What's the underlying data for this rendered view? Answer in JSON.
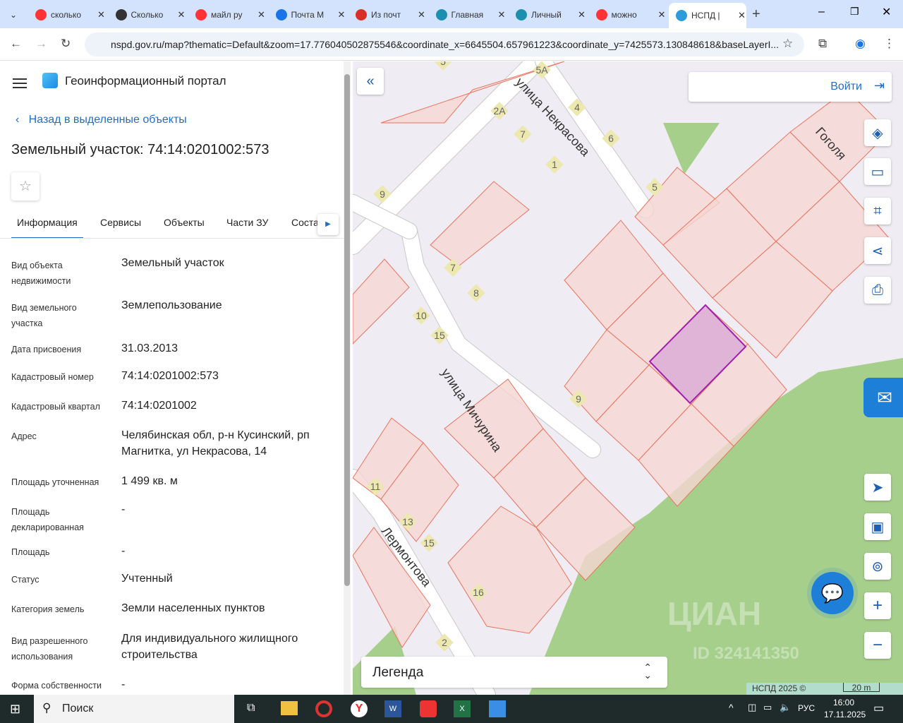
{
  "browser": {
    "tabs": [
      {
        "title": "сколько",
        "icon": "yandex-icon",
        "color": "#f33"
      },
      {
        "title": "Сколько",
        "icon": "emblem-icon",
        "color": "#333"
      },
      {
        "title": "майл ру",
        "icon": "yandex-icon",
        "color": "#f33"
      },
      {
        "title": "Почта М",
        "icon": "mail-icon",
        "color": "#1a73e8"
      },
      {
        "title": "Из почт",
        "icon": "pdf-icon",
        "color": "#d93025"
      },
      {
        "title": "Главная",
        "icon": "gosuslugi-icon",
        "color": "#1a8fb0"
      },
      {
        "title": "Личный",
        "icon": "gosuslugi-icon",
        "color": "#1a8fb0"
      },
      {
        "title": "можно",
        "icon": "yandex-icon",
        "color": "#f33"
      },
      {
        "title": "НСПД |",
        "icon": "nspd-icon",
        "color": "#2d9cdb",
        "active": true
      }
    ],
    "url": "nspd.gov.ru/map?thematic=Default&zoom=17.776040502875546&coordinate_x=6645504.657961223&coordinate_y=7425573.130848618&baseLayerI..."
  },
  "panel": {
    "app_title": "Геоинформационный портал",
    "back_link": "Назад в выделенные объекты",
    "object_title": "Земельный участок: 74:14:0201002:573",
    "tabs": [
      "Информация",
      "Сервисы",
      "Объекты",
      "Части ЗУ",
      "Состав"
    ],
    "active_tab": 0,
    "fields": [
      {
        "k": "Вид объекта недвижимости",
        "v": "Земельный участок"
      },
      {
        "k": "Вид земельного участка",
        "v": "Землепользование"
      },
      {
        "k": "Дата присвоения",
        "v": "31.03.2013"
      },
      {
        "k": "Кадастровый номер",
        "v": "74:14:0201002:573"
      },
      {
        "k": "Кадастровый квартал",
        "v": "74:14:0201002"
      },
      {
        "k": "Адрес",
        "v": "Челябинская обл, р-н Кусинский, рп Магнитка, ул Некрасова, 14"
      },
      {
        "k": "Площадь уточненная",
        "v": "1 499 кв. м"
      },
      {
        "k": "Площадь декларированная",
        "v": "-"
      },
      {
        "k": "Площадь",
        "v": "-"
      },
      {
        "k": "Статус",
        "v": "Учтенный"
      },
      {
        "k": "Категория земель",
        "v": "Земли населенных пунктов"
      },
      {
        "k": "Вид разрешенного использования",
        "v": "Для индивидуального жилищного строительства"
      },
      {
        "k": "Форма собственности",
        "v": "-"
      }
    ]
  },
  "map": {
    "login": "Войти",
    "legend": "Легенда",
    "copyright": "НСПД 2025 ©",
    "scale": "20 m",
    "watermark": "ЦИАН",
    "watermark_id": "ID 324141350",
    "streets": [
      "улица Некрасова",
      "улица Мичурина",
      "Лермонтова",
      "Гоголя"
    ],
    "house_numbers": [
      "5",
      "5А",
      "2А",
      "4",
      "7",
      "6",
      "1",
      "9",
      "5",
      "7",
      "8",
      "10",
      "15",
      "9",
      "11",
      "13",
      "15",
      "16",
      "2"
    ],
    "colors": {
      "parcel_fill": "#f6d6d2",
      "parcel_stroke": "#e8745f",
      "selected": "#a020b0",
      "green": "#a7cf8c",
      "accent": "#1e6fc8"
    }
  },
  "taskbar": {
    "search": "Поиск",
    "lang": "РУС",
    "time": "16:00",
    "date": "17.11.2025"
  }
}
